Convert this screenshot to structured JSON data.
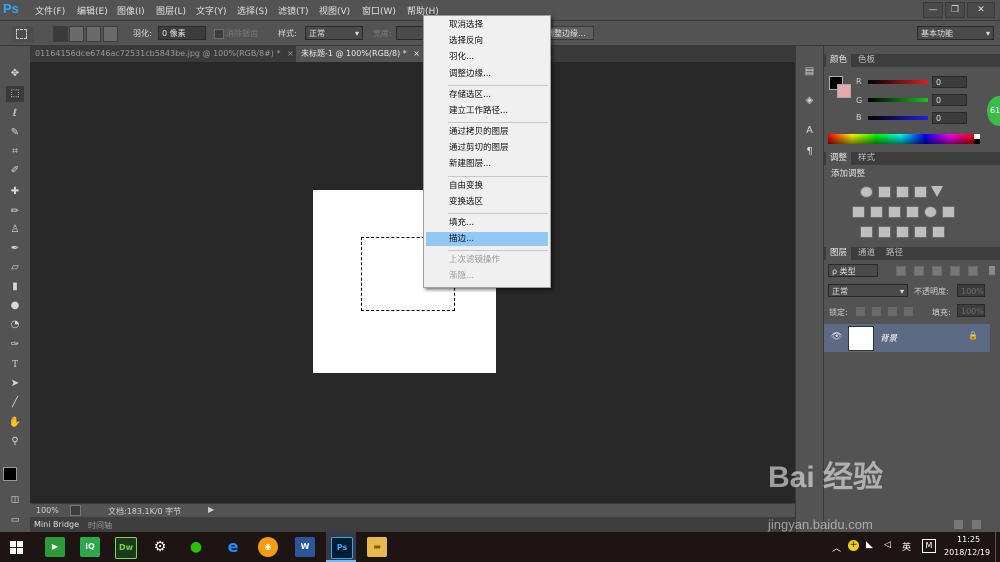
{
  "app": {
    "logo": "Ps"
  },
  "menu": [
    "文件(F)",
    "编辑(E)",
    "图像(I)",
    "图层(L)",
    "文字(Y)",
    "选择(S)",
    "滤镜(T)",
    "视图(V)",
    "窗口(W)",
    "帮助(H)"
  ],
  "window_controls": {
    "minimize": "—",
    "restore": "❐",
    "close": "✕"
  },
  "options": {
    "feather_label": "羽化:",
    "feather_value": "0 像素",
    "antialias_label": "消除锯齿",
    "style_label": "样式:",
    "style_value": "正常",
    "width_label": "宽度:",
    "refine_edge": "调整边缘...",
    "workspace": "基本功能"
  },
  "tabs": [
    {
      "label": "01164156dce6746ac72531cb5843be.jpg @ 100%(RGB/8#) *",
      "active": false
    },
    {
      "label": "未标题-1 @ 100%(RGB/8) *",
      "active": true
    }
  ],
  "context_menu": {
    "items": [
      {
        "label": "取消选择",
        "state": "normal"
      },
      {
        "label": "选择反向",
        "state": "normal"
      },
      {
        "label": "羽化...",
        "state": "normal"
      },
      {
        "label": "调整边缘...",
        "state": "normal"
      },
      {
        "label": "存储选区...",
        "state": "normal"
      },
      {
        "label": "建立工作路径...",
        "state": "normal"
      },
      {
        "label": "通过拷贝的图层",
        "state": "normal"
      },
      {
        "label": "通过剪切的图层",
        "state": "normal"
      },
      {
        "label": "新建图层...",
        "state": "normal"
      },
      {
        "label": "自由变换",
        "state": "normal"
      },
      {
        "label": "变换选区",
        "state": "normal"
      },
      {
        "label": "填充...",
        "state": "normal"
      },
      {
        "label": "描边...",
        "state": "highlighted"
      },
      {
        "label": "上次滤镜操作",
        "state": "disabled"
      },
      {
        "label": "渐隐...",
        "state": "disabled"
      }
    ]
  },
  "status": {
    "zoom": "100%",
    "doc_info": "文档:183.1K/0 字节"
  },
  "bottom_tabs": [
    "Mini Bridge",
    "时间轴"
  ],
  "color_panel": {
    "tabs": [
      "颜色",
      "色板"
    ],
    "channels": [
      {
        "label": "R",
        "value": "0",
        "color": "#e02020"
      },
      {
        "label": "G",
        "value": "0",
        "color": "#20c020"
      },
      {
        "label": "B",
        "value": "0",
        "color": "#2020e0"
      }
    ]
  },
  "adjust_panel": {
    "tabs": [
      "调整",
      "样式"
    ],
    "title": "添加调整"
  },
  "layers_panel": {
    "tabs": [
      "图层",
      "通道",
      "路径"
    ],
    "filter_kind": "ρ 类型",
    "blend_mode": "正常",
    "opacity_label": "不透明度:",
    "opacity_value": "100%",
    "lock_label": "锁定:",
    "fill_label": "填充:",
    "fill_value": "100%",
    "layers": [
      {
        "name": "背景",
        "locked": true,
        "visible": true
      }
    ]
  },
  "clock": {
    "time": "11:25",
    "date": "2018/12/19"
  },
  "tray": {
    "ime": "英",
    "ime2": "M"
  },
  "badge": "61",
  "watermark": {
    "text": "Bai 经验",
    "url": "jingyan.baidu.com"
  }
}
